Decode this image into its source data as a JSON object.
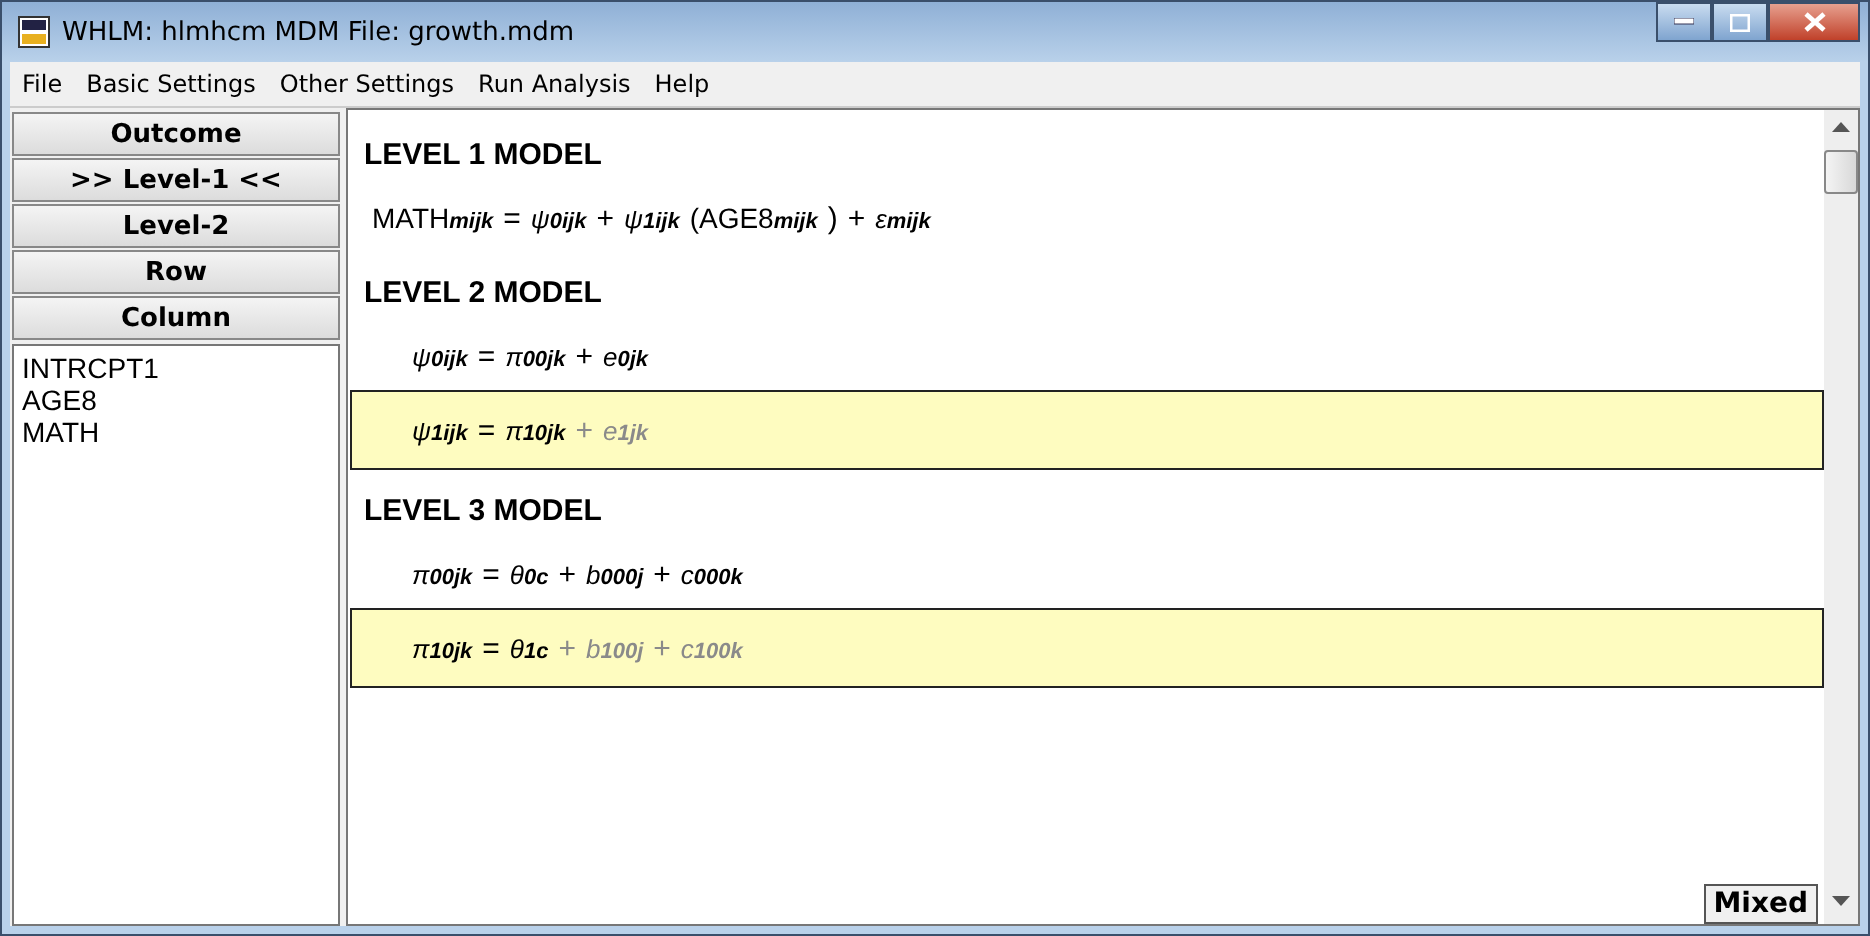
{
  "window": {
    "title": "WHLM: hlmhcm MDM File: growth.mdm"
  },
  "menu": [
    "File",
    "Basic Settings",
    "Other Settings",
    "Run Analysis",
    "Help"
  ],
  "side_buttons": [
    "Outcome",
    ">> Level-1 <<",
    "Level-2",
    "Row",
    "Column"
  ],
  "variables": [
    "INTRCPT1",
    "AGE8",
    "MATH"
  ],
  "sections": [
    {
      "title": "LEVEL 1 MODEL",
      "equations": [
        {
          "selected": false,
          "indent": false,
          "terms": [
            {
              "base": "MATH",
              "sub": "mijk",
              "dim": false
            },
            {
              "base": "=",
              "dim": false
            },
            {
              "base": "ψ",
              "sub": "0ijk",
              "dim": false
            },
            {
              "base": "+",
              "dim": false
            },
            {
              "base": "ψ",
              "sub": "1ijk",
              "dim": false
            },
            {
              "base": "(AGE8",
              "sub": "mijk",
              "dim": false
            },
            {
              "base": ")",
              "dim": false
            },
            {
              "base": "+",
              "dim": false
            },
            {
              "base": "ε",
              "sub": "mijk",
              "dim": false
            }
          ]
        }
      ]
    },
    {
      "title": "LEVEL 2 MODEL",
      "equations": [
        {
          "selected": false,
          "indent": true,
          "terms": [
            {
              "base": "ψ",
              "sub": "0ijk",
              "dim": false
            },
            {
              "base": "=",
              "dim": false
            },
            {
              "base": "π",
              "sub": "00jk",
              "dim": false
            },
            {
              "base": "+",
              "dim": false
            },
            {
              "base": "e",
              "sub": "0jk",
              "dim": false
            }
          ]
        },
        {
          "selected": true,
          "indent": true,
          "terms": [
            {
              "base": "ψ",
              "sub": "1ijk",
              "dim": false
            },
            {
              "base": "=",
              "dim": false
            },
            {
              "base": "π",
              "sub": "10jk",
              "dim": false
            },
            {
              "base": "+",
              "dim": true
            },
            {
              "base": "e",
              "sub": "1jk",
              "dim": true
            }
          ]
        }
      ]
    },
    {
      "title": "LEVEL 3 MODEL",
      "equations": [
        {
          "selected": false,
          "indent": true,
          "terms": [
            {
              "base": "π",
              "sub": "00jk",
              "dim": false
            },
            {
              "base": "=",
              "dim": false
            },
            {
              "base": "θ",
              "sub": "0c",
              "dim": false
            },
            {
              "base": "+",
              "dim": false
            },
            {
              "base": "b",
              "sub": "000j",
              "dim": false
            },
            {
              "base": "+",
              "dim": false
            },
            {
              "base": "c",
              "sub": "000k",
              "dim": false
            }
          ]
        },
        {
          "selected": true,
          "indent": true,
          "terms": [
            {
              "base": "π",
              "sub": "10jk",
              "dim": false
            },
            {
              "base": "=",
              "dim": false
            },
            {
              "base": "θ",
              "sub": "1c",
              "dim": false
            },
            {
              "base": "+",
              "dim": true
            },
            {
              "base": "b",
              "sub": "100j",
              "dim": true
            },
            {
              "base": "+",
              "dim": true
            },
            {
              "base": "c",
              "sub": "100k",
              "dim": true
            }
          ]
        }
      ]
    }
  ],
  "mixed_button": "Mixed"
}
